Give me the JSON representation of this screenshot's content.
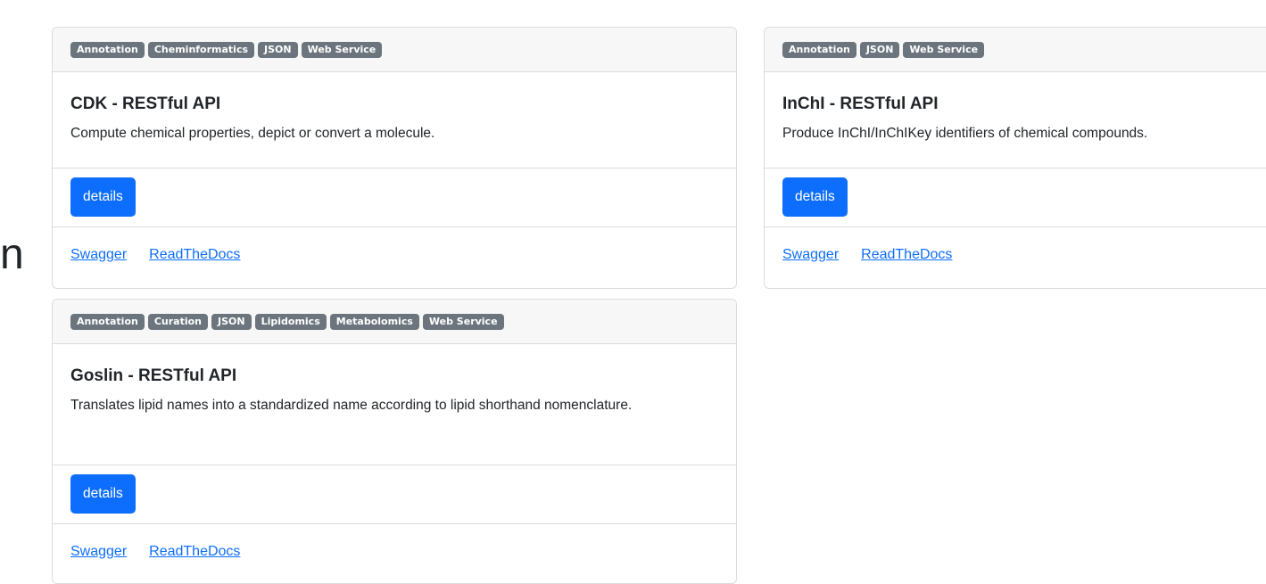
{
  "edge_fragment": "n",
  "cards": [
    {
      "tags": [
        "Annotation",
        "Cheminformatics",
        "JSON",
        "Web Service"
      ],
      "title": "CDK - RESTful API",
      "description": "Compute chemical properties, depict or convert a molecule.",
      "button_label": "details",
      "links": [
        "Swagger",
        "ReadTheDocs"
      ]
    },
    {
      "tags": [
        "Annotation",
        "JSON",
        "Web Service"
      ],
      "title": "InChI - RESTful API",
      "description": "Produce InChI/InChIKey identifiers of chemical compounds.",
      "button_label": "details",
      "links": [
        "Swagger",
        "ReadTheDocs"
      ]
    },
    {
      "tags": [
        "Annotation",
        "Curation",
        "JSON",
        "Lipidomics",
        "Metabolomics",
        "Web Service"
      ],
      "title": "Goslin - RESTful API",
      "description": "Translates lipid names into a standardized name according to lipid shorthand nomenclature.",
      "button_label": "details",
      "links": [
        "Swagger",
        "ReadTheDocs"
      ]
    }
  ]
}
